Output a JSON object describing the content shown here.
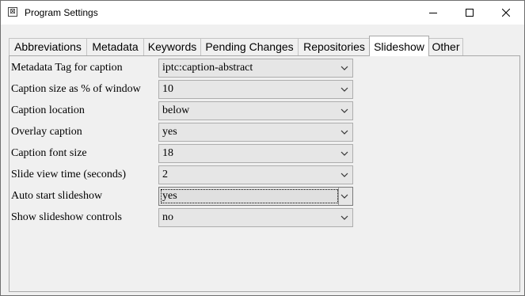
{
  "window": {
    "title": "Program Settings",
    "app_icon_glyph": "⊠",
    "controls": {
      "minimize": "—",
      "maximize": "☐",
      "close": "✕"
    }
  },
  "tabs": [
    {
      "label": "Abbreviations",
      "active": false
    },
    {
      "label": "Metadata",
      "active": false
    },
    {
      "label": "Keywords",
      "active": false
    },
    {
      "label": "Pending Changes",
      "active": false
    },
    {
      "label": "Repositories",
      "active": false
    },
    {
      "label": "Slideshow",
      "active": true
    },
    {
      "label": "Other",
      "active": false
    }
  ],
  "settings": [
    {
      "label": "Metadata Tag for caption",
      "value": "iptc:caption-abstract"
    },
    {
      "label": "Caption size as % of window",
      "value": "10"
    },
    {
      "label": "Caption location",
      "value": "below"
    },
    {
      "label": "Overlay caption",
      "value": "yes"
    },
    {
      "label": "Caption font size",
      "value": "18"
    },
    {
      "label": "Slide view time (seconds)",
      "value": "2"
    },
    {
      "label": "Auto start slideshow",
      "value": "yes",
      "focused": true
    },
    {
      "label": "Show slideshow controls",
      "value": "no"
    }
  ],
  "icons": {
    "app": "app-icon",
    "dropdown": "chevron-down-icon"
  }
}
